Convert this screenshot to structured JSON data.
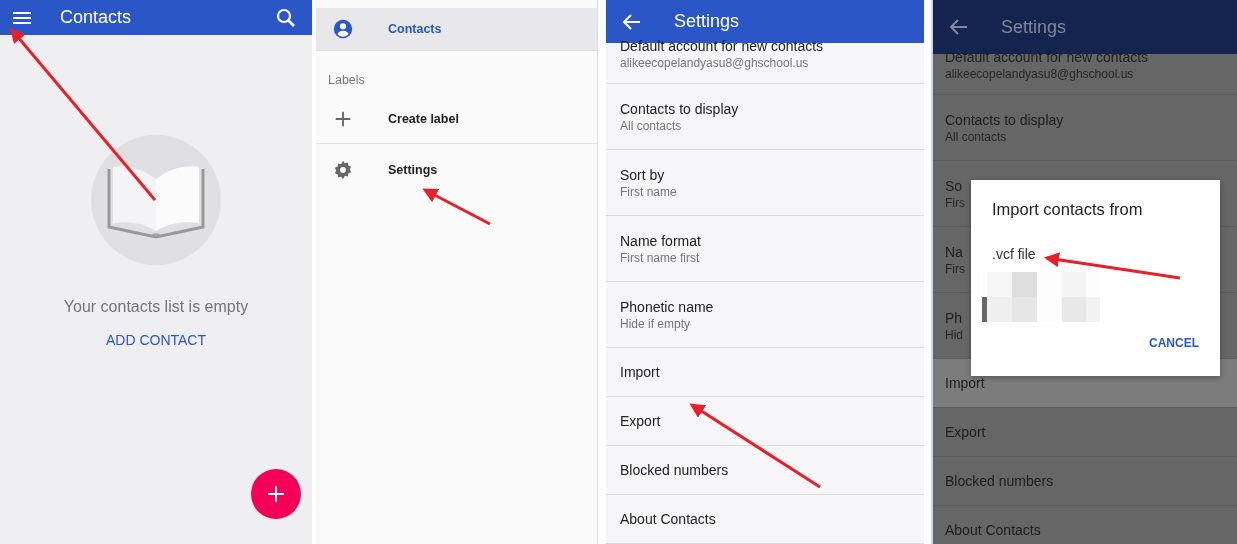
{
  "panels": [
    {
      "kind": "contacts",
      "title": "Contacts",
      "empty_message": "Your contacts list is empty",
      "action": "ADD CONTACT"
    },
    {
      "kind": "drawer",
      "items": [
        {
          "kind": "account",
          "label": "Contacts",
          "selected": true
        },
        {
          "kind": "header",
          "label": "Labels"
        },
        {
          "kind": "add",
          "label": "Create label",
          "selected": false
        },
        {
          "kind": "settings",
          "label": "Settings",
          "selected": false
        }
      ]
    },
    {
      "kind": "settings",
      "title": "Settings",
      "items": [
        {
          "title": "Default account for new contacts",
          "subtitle": "alikeecopelandyasu8@ghschool.us"
        },
        {
          "title": "Contacts to display",
          "subtitle": "All contacts"
        },
        {
          "title": "Sort by",
          "subtitle": "First name"
        },
        {
          "title": "Name format",
          "subtitle": "First name first"
        },
        {
          "title": "Phonetic name",
          "subtitle": "Hide if empty"
        },
        {
          "title": "Import"
        },
        {
          "title": "Export"
        },
        {
          "title": "Blocked numbers"
        },
        {
          "title": "About Contacts"
        }
      ]
    },
    {
      "kind": "settings_dialog",
      "title": "Settings",
      "items": [
        {
          "title": "Default account for new contacts",
          "subtitle": "alikeecopelandyasu8@ghschool.us",
          "selected": false
        },
        {
          "title": "Contacts to display",
          "subtitle": "All contacts",
          "selected": false
        },
        {
          "title": "So",
          "subtitle": "Firs",
          "selected": false
        },
        {
          "title": "Na",
          "subtitle": "Firs",
          "selected": false
        },
        {
          "title": "Ph",
          "subtitle": "Hid",
          "selected": false
        },
        {
          "title": "Import",
          "selected": true
        },
        {
          "title": "Export",
          "selected": false
        },
        {
          "title": "Blocked numbers",
          "selected": false
        },
        {
          "title": "About Contacts",
          "selected": false
        }
      ],
      "dialog": {
        "title": "Import contacts from",
        "options": [
          ".vcf file"
        ],
        "buttons": [
          "CANCEL"
        ]
      }
    }
  ]
}
